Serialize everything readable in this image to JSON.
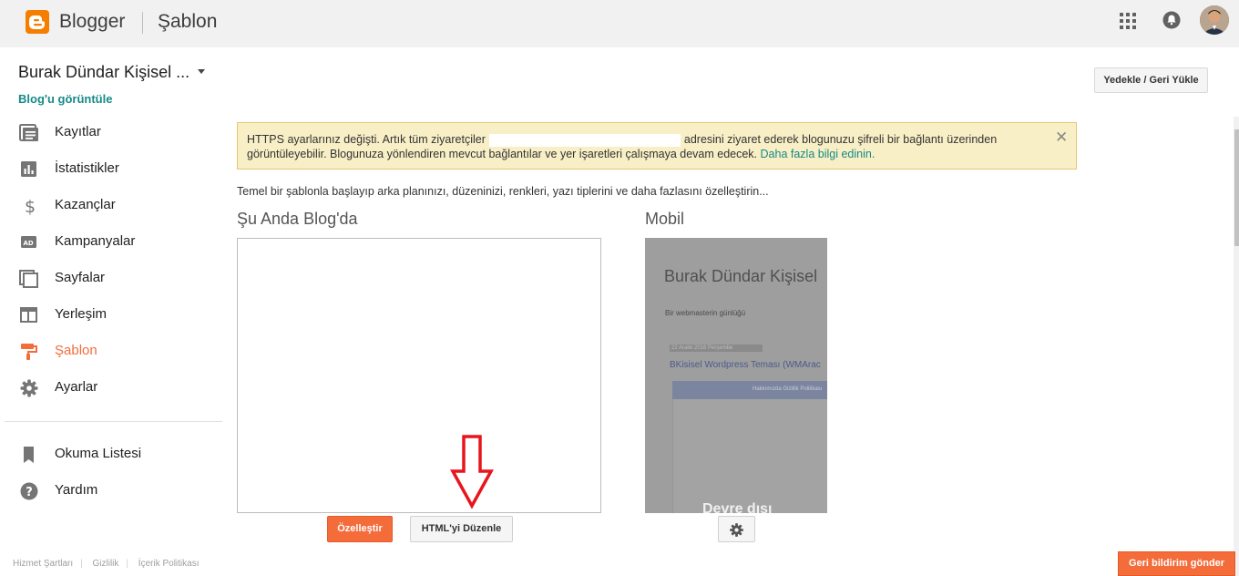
{
  "app": {
    "brand": "Blogger",
    "section": "Şablon"
  },
  "blog": {
    "name": "Burak Dündar Kişisel ...",
    "view_link": "Blog'u görüntüle"
  },
  "sidebar": {
    "items": [
      {
        "label": "Kayıtlar",
        "icon": "posts-icon"
      },
      {
        "label": "İstatistikler",
        "icon": "stats-icon"
      },
      {
        "label": "Kazançlar",
        "icon": "dollar-icon"
      },
      {
        "label": "Kampanyalar",
        "icon": "ad-icon"
      },
      {
        "label": "Sayfalar",
        "icon": "pages-icon"
      },
      {
        "label": "Yerleşim",
        "icon": "layout-icon"
      },
      {
        "label": "Şablon",
        "icon": "paint-roller-icon",
        "active": true
      },
      {
        "label": "Ayarlar",
        "icon": "gear-icon"
      }
    ],
    "secondary": [
      {
        "label": "Okuma Listesi",
        "icon": "bookmark-icon"
      },
      {
        "label": "Yardım",
        "icon": "help-icon"
      }
    ],
    "footer": [
      "Hizmet Şartları",
      "Gizlilik",
      "İçerik Politikası"
    ]
  },
  "toolbar": {
    "backup_label": "Yedekle / Geri Yükle"
  },
  "alert": {
    "text_before": "HTTPS ayarlarınız değişti. Artık tüm ziyaretçiler",
    "text_after": "adresini ziyaret ederek blogunuzu şifreli bir bağlantı üzerinden görüntüleyebilir. Blogunuza yönlendiren mevcut bağlantılar ve yer işaretleri çalışmaya devam edecek.",
    "link": "Daha fazla bilgi edinin.",
    "close": "✕"
  },
  "main": {
    "intro": "Temel bir şablonla başlayıp arka planınızı, düzeninizi, renkleri, yazı tiplerini ve daha fazlasını özelleştirin...",
    "current_heading": "Şu Anda Blog'da",
    "mobile_heading": "Mobil",
    "customize_label": "Özelleştir",
    "edit_html_label": "HTML'yi Düzenle"
  },
  "mobile_preview": {
    "title": "Burak Dündar Kişisel",
    "subtitle": "Bir webmasterin günlüğü",
    "date": "22 Aralık 2016 Perşembe",
    "post_title": "BKisisel Wordpress Teması (WMArac",
    "banner_text": "Hakkımızda   Gizlilik Politikası",
    "disabled_text": "Devre dışı"
  },
  "feedback": {
    "label": "Geri bildirim gönder"
  },
  "colors": {
    "accent": "#f36c3a",
    "link": "#168a87",
    "alert_bg": "#f8efc6"
  }
}
